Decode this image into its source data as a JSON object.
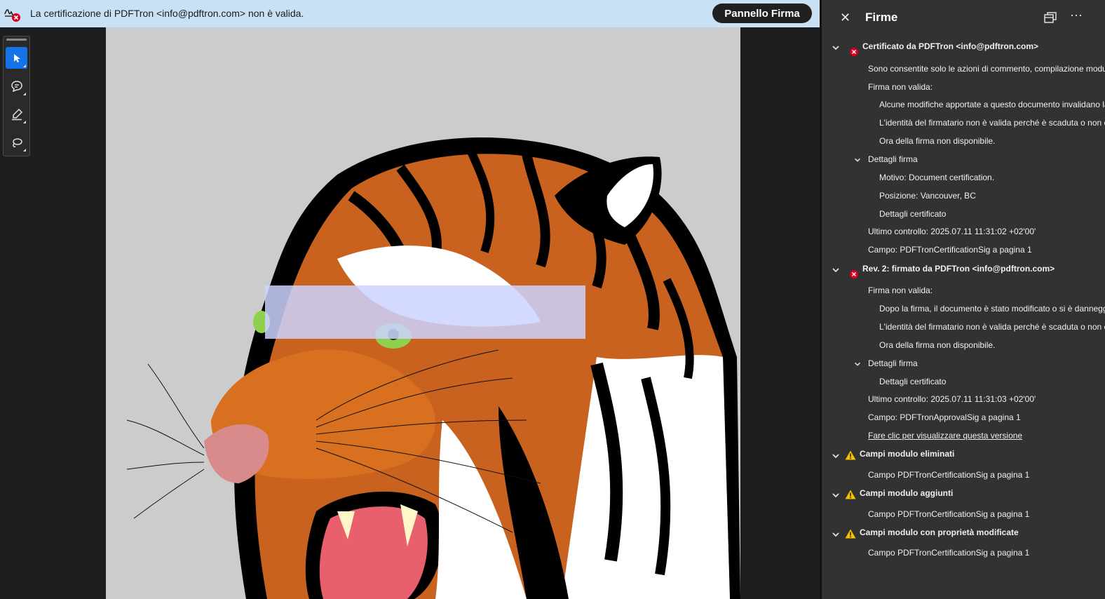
{
  "banner": {
    "message": "La certificazione di PDFTron <info@pdftron.com> non è valida.",
    "button_label": "Pannello Firma"
  },
  "toolbar": {
    "tools": [
      "select-tool",
      "comment-tool",
      "highlight-tool",
      "lasso-tool"
    ],
    "active": "select-tool"
  },
  "side_panel": {
    "title": "Firme",
    "sig1": {
      "header": "Certificato da PDFTron <info@pdftron.com>",
      "permissions": "Sono consentite solo le azioni di commento, compilazione modulo, firma e aggiunta pagina.",
      "invalid_label": "Firma non valida:",
      "reason1": "Alcune modifiche apportate a questo documento invalidano la firma.",
      "reason2": "L'identità del firmatario non è valida perché è scaduta o non è ancora valida.",
      "reason3": "Ora della firma non disponibile.",
      "details_label": "Dettagli firma",
      "motivo": "Motivo: Document certification.",
      "posizione": "Posizione: Vancouver, BC",
      "cert_details": "Dettagli certificato",
      "last_check": "Ultimo controllo: 2025.07.11 11:31:02 +02'00'",
      "field": "Campo: PDFTronCertificationSig a pagina 1"
    },
    "sig2": {
      "header": "Rev. 2: firmato da PDFTron <info@pdftron.com>",
      "invalid_label": "Firma non valida:",
      "reason1": "Dopo la firma, il documento è stato modificato o si è danneggiato.",
      "reason2": "L'identità del firmatario non è valida perché è scaduta o non è ancora valida.",
      "reason3": "Ora della firma non disponibile.",
      "details_label": "Dettagli firma",
      "cert_details": "Dettagli certificato",
      "last_check": "Ultimo controllo: 2025.07.11 11:31:03 +02'00'",
      "field": "Campo: PDFTronApprovalSig a pagina 1",
      "view_version_link": "Fare clic per visualizzare questa versione"
    },
    "removed_fields": {
      "header": "Campi modulo eliminati",
      "item": "Campo PDFTronCertificationSig a pagina 1"
    },
    "added_fields": {
      "header": "Campi modulo aggiunti",
      "item": "Campo PDFTronCertificationSig a pagina 1"
    },
    "modified_fields": {
      "header": "Campi modulo con proprietà modificate",
      "item": "Campo PDFTronCertificationSig a pagina 1"
    }
  },
  "colors": {
    "banner_bg": "#c9e1f5",
    "accent": "#1473e6",
    "error": "#d7001f",
    "warning": "#f2c200",
    "panel_bg": "#323232"
  }
}
